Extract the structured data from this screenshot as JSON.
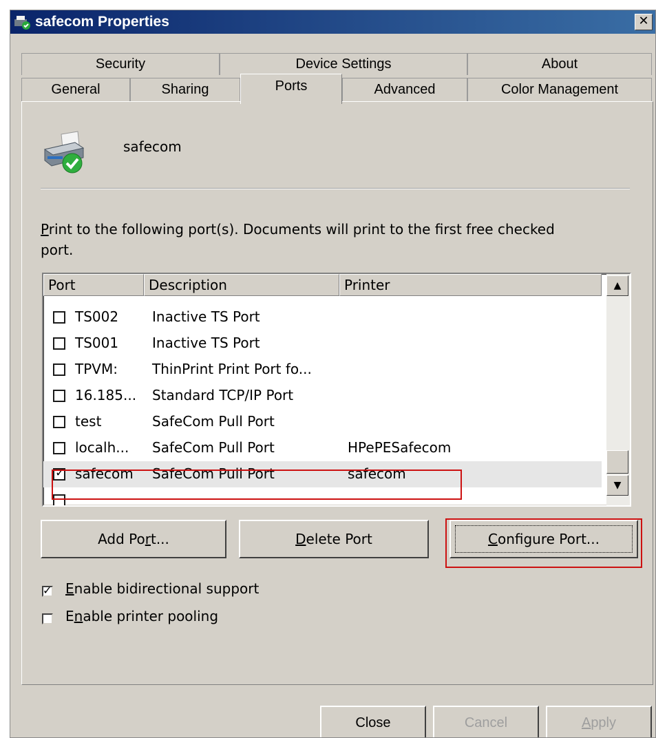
{
  "window": {
    "title": "safecom Properties",
    "close_glyph": "✕"
  },
  "tabs": {
    "row1": [
      "Security",
      "Device Settings",
      "About"
    ],
    "row2": [
      "General",
      "Sharing",
      "Ports",
      "Advanced",
      "Color Management"
    ],
    "active": "Ports"
  },
  "printer": {
    "name": "safecom",
    "icon": "printer-check-icon"
  },
  "instruction": {
    "accel": "P",
    "text": "rint to the following port(s). Documents will print to the first free checked port."
  },
  "ports_list": {
    "columns": [
      "Port",
      "Description",
      "Printer"
    ],
    "rows": [
      {
        "port": "TS002",
        "description": "Inactive TS Port",
        "printer": "",
        "checked": false
      },
      {
        "port": "TS001",
        "description": "Inactive TS Port",
        "printer": "",
        "checked": false
      },
      {
        "port": "TPVM:",
        "description": "ThinPrint Print Port fo...",
        "printer": "",
        "checked": false
      },
      {
        "port": "16.185...",
        "description": "Standard TCP/IP Port",
        "printer": "",
        "checked": false
      },
      {
        "port": "test",
        "description": "SafeCom Pull Port",
        "printer": "",
        "checked": false
      },
      {
        "port": "localh...",
        "description": "SafeCom Pull Port",
        "printer": "HPePESafecom",
        "checked": false
      },
      {
        "port": "safecom",
        "description": "SafeCom Pull Port",
        "printer": "safecom",
        "checked": true
      }
    ],
    "selected_index": 6
  },
  "buttons": {
    "add_port": {
      "pre": "Add Po",
      "accel": "r",
      "post": "t..."
    },
    "delete_port": {
      "pre": "",
      "accel": "D",
      "post": "elete Port"
    },
    "configure_port": {
      "pre": "",
      "accel": "C",
      "post": "onfigure Port..."
    }
  },
  "options": {
    "bidirectional": {
      "accel": "E",
      "text": "nable bidirectional support",
      "checked": true
    },
    "pooling": {
      "pre": "E",
      "accel": "n",
      "text": "able printer pooling",
      "checked": false
    }
  },
  "footer": {
    "close": "Close",
    "cancel": "Cancel",
    "apply_accel": "A",
    "apply_rest": "pply"
  },
  "colors": {
    "highlight": "#cc1010",
    "titlebar": "#0a246a"
  }
}
